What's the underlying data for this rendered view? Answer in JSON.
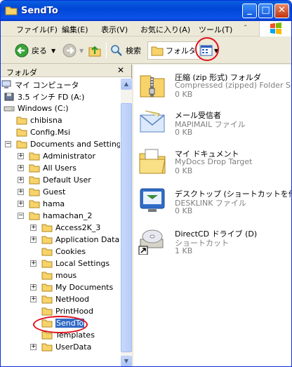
{
  "window": {
    "title": "SendTo"
  },
  "menu": [
    {
      "label": "ファイル(F)"
    },
    {
      "label": "編集(E)"
    },
    {
      "label": "表示(V)"
    },
    {
      "label": "お気に入り(A)"
    },
    {
      "label": "ツール(T)"
    },
    {
      "label": "＾"
    }
  ],
  "toolbar": {
    "back_label": "戻る",
    "search_label": "検索",
    "folders_label": "フォルダ"
  },
  "folder_pane": {
    "title": "フォルダ",
    "tree": [
      {
        "label": "マイ コンピュータ",
        "indent": 0,
        "icon": "computer-icon",
        "expander": ""
      },
      {
        "label": "3.5 インチ FD (A:)",
        "indent": 1,
        "icon": "floppy-icon",
        "expander": ""
      },
      {
        "label": "Windows (C:)",
        "indent": 1,
        "icon": "drive-icon",
        "expander": "−"
      },
      {
        "label": "chibisna",
        "indent": 2,
        "icon": "folder-icon",
        "expander": ""
      },
      {
        "label": "Config.Msi",
        "indent": 2,
        "icon": "folder-icon",
        "expander": ""
      },
      {
        "label": "Documents and Settings",
        "indent": 2,
        "icon": "folder-icon",
        "expander": "−"
      },
      {
        "label": "Administrator",
        "indent": 3,
        "icon": "folder-icon",
        "expander": "+"
      },
      {
        "label": "All Users",
        "indent": 3,
        "icon": "folder-icon",
        "expander": "+"
      },
      {
        "label": "Default User",
        "indent": 3,
        "icon": "folder-icon",
        "expander": "+"
      },
      {
        "label": "Guest",
        "indent": 3,
        "icon": "folder-icon",
        "expander": "+"
      },
      {
        "label": "hama",
        "indent": 3,
        "icon": "folder-icon",
        "expander": "+"
      },
      {
        "label": "hamachan_2",
        "indent": 3,
        "icon": "folder-icon",
        "expander": "−"
      },
      {
        "label": "Access2K_3",
        "indent": 4,
        "icon": "folder-icon",
        "expander": "+"
      },
      {
        "label": "Application Data",
        "indent": 4,
        "icon": "folder-icon",
        "expander": "+"
      },
      {
        "label": "Cookies",
        "indent": 4,
        "icon": "folder-icon",
        "expander": ""
      },
      {
        "label": "Local Settings",
        "indent": 4,
        "icon": "folder-icon",
        "expander": "+"
      },
      {
        "label": "mous",
        "indent": 4,
        "icon": "folder-icon",
        "expander": ""
      },
      {
        "label": "My Documents",
        "indent": 4,
        "icon": "folder-icon",
        "expander": "+"
      },
      {
        "label": "NetHood",
        "indent": 4,
        "icon": "folder-icon",
        "expander": "+"
      },
      {
        "label": "PrintHood",
        "indent": 4,
        "icon": "folder-icon",
        "expander": ""
      },
      {
        "label": "SendTo",
        "indent": 4,
        "icon": "folder-icon",
        "expander": "",
        "selected": true
      },
      {
        "label": "Templates",
        "indent": 4,
        "icon": "folder-icon",
        "expander": ""
      },
      {
        "label": "UserData",
        "indent": 4,
        "icon": "folder-icon",
        "expander": "+"
      }
    ]
  },
  "files": [
    {
      "name": "圧縮 (zip 形式) フォルダ",
      "type": "Compressed (zipped) Folder Ser",
      "size": "0 KB",
      "icon": "zip-folder-icon"
    },
    {
      "name": "メール受信者",
      "type": "MAPIMAIL ファイル",
      "size": "0 KB",
      "icon": "mail-envelope-icon"
    },
    {
      "name": "マイ ドキュメント",
      "type": "MyDocs Drop Target",
      "size": "0 KB",
      "icon": "my-documents-icon"
    },
    {
      "name": "デスクトップ (ショートカットを作成)",
      "type": "DESKLINK ファイル",
      "size": "0 KB",
      "icon": "desktop-shortcut-icon"
    },
    {
      "name": "DirectCD ドライブ (D)",
      "type": "ショートカット",
      "size": "1 KB",
      "icon": "cd-drive-icon"
    }
  ],
  "colors": {
    "title_bar": "#0046d5",
    "selection": "#316ac5",
    "highlight_circle": "#e0101a"
  }
}
